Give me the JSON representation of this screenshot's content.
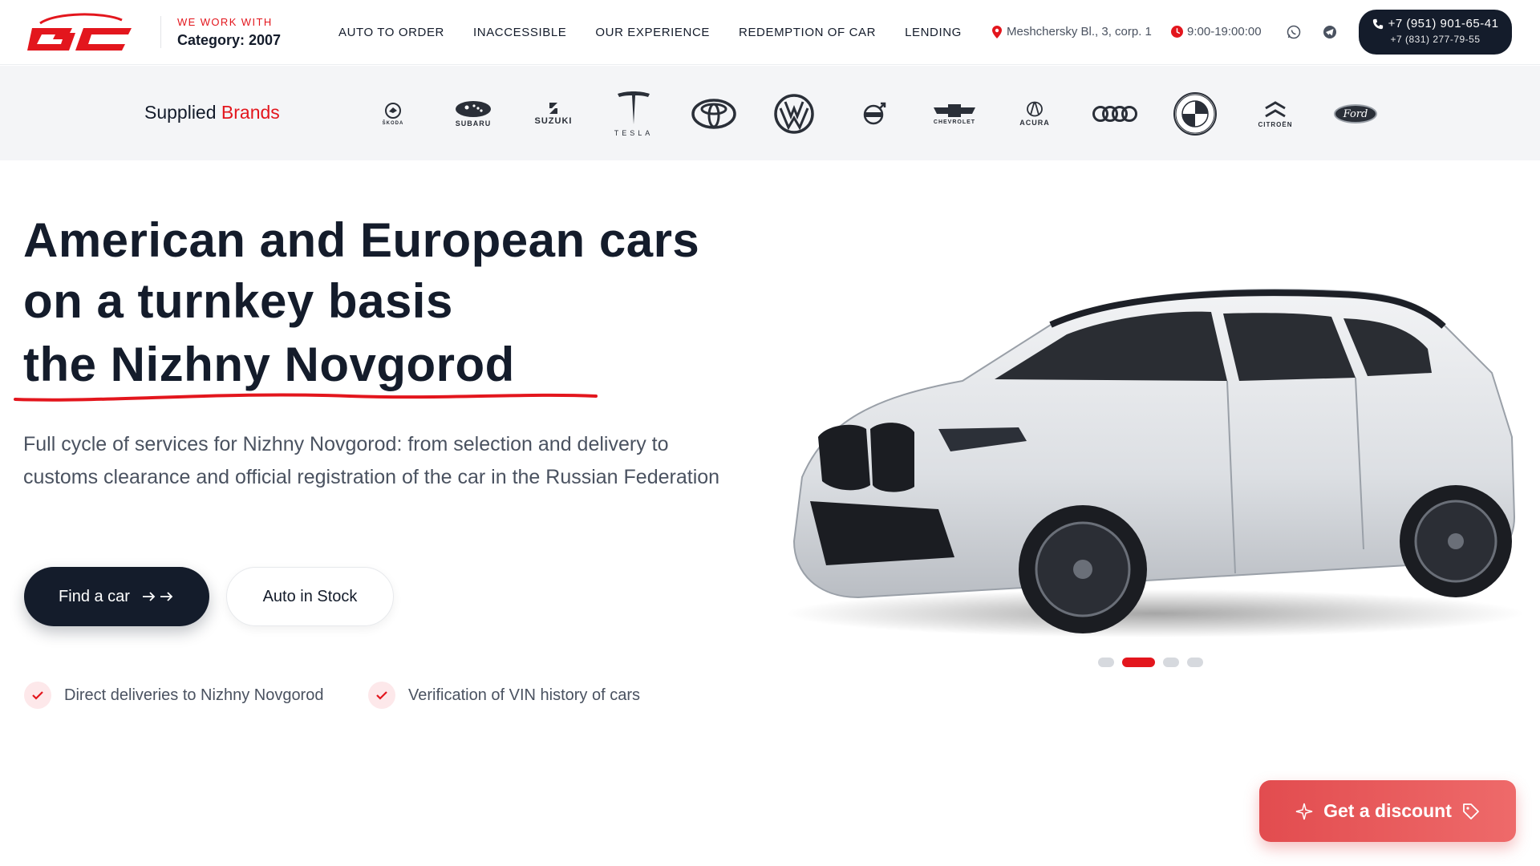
{
  "header": {
    "logo_text": "GC",
    "since_label": "WE WORK WITH",
    "since_value": "Category: 2007",
    "nav": [
      {
        "label": "AUTO TO ORDER"
      },
      {
        "label": "INACCESSIBLE"
      },
      {
        "label": "OUR EXPERIENCE"
      },
      {
        "label": "REDEMPTION OF CAR"
      },
      {
        "label": "LENDING"
      }
    ],
    "address": "Meshchersky Bl., 3, corp. 1",
    "hours": "9:00-19:00:00",
    "phone_main": "+7 (951) 901-65-41",
    "phone_sub": "+7 (831) 277-79-55"
  },
  "brands": {
    "title_part1": "Supplied",
    "title_part2": "Brands",
    "items": [
      {
        "name": "skoda-logo",
        "label": "ŠKODA"
      },
      {
        "name": "subaru-logo",
        "label": "SUBARU"
      },
      {
        "name": "suzuki-logo",
        "label": "SUZUKI"
      },
      {
        "name": "tesla-logo",
        "label": "TESLA"
      },
      {
        "name": "toyota-logo",
        "label": ""
      },
      {
        "name": "volkswagen-logo",
        "label": ""
      },
      {
        "name": "volvo-logo",
        "label": "VOLVO"
      },
      {
        "name": "chevrolet-logo",
        "label": "CHEVROLET"
      },
      {
        "name": "acura-logo",
        "label": "ACURA"
      },
      {
        "name": "audi-logo",
        "label": ""
      },
      {
        "name": "bmw-logo",
        "label": ""
      },
      {
        "name": "citroen-logo",
        "label": "CITROËN"
      },
      {
        "name": "ford-logo",
        "label": "Ford"
      }
    ]
  },
  "hero": {
    "title_line1": "American and European cars",
    "title_line2": "on a turnkey basis",
    "title_city": "the Nizhny Novgorod",
    "description": "Full cycle of services for Nizhny Novgorod: from selection and delivery to customs clearance and official registration of the car in the Russian Federation",
    "btn_find": "Find a car",
    "btn_stock": "Auto in Stock",
    "features": [
      {
        "label": "Direct deliveries to Nizhny Novgorod"
      },
      {
        "label": "Verification of VIN history of cars"
      }
    ]
  },
  "slider": {
    "count": 4,
    "active_index": 1
  },
  "discount": {
    "label": "Get a discount"
  },
  "colors": {
    "accent": "#e3161d",
    "dark": "#141c2b",
    "muted": "#4a5260"
  }
}
